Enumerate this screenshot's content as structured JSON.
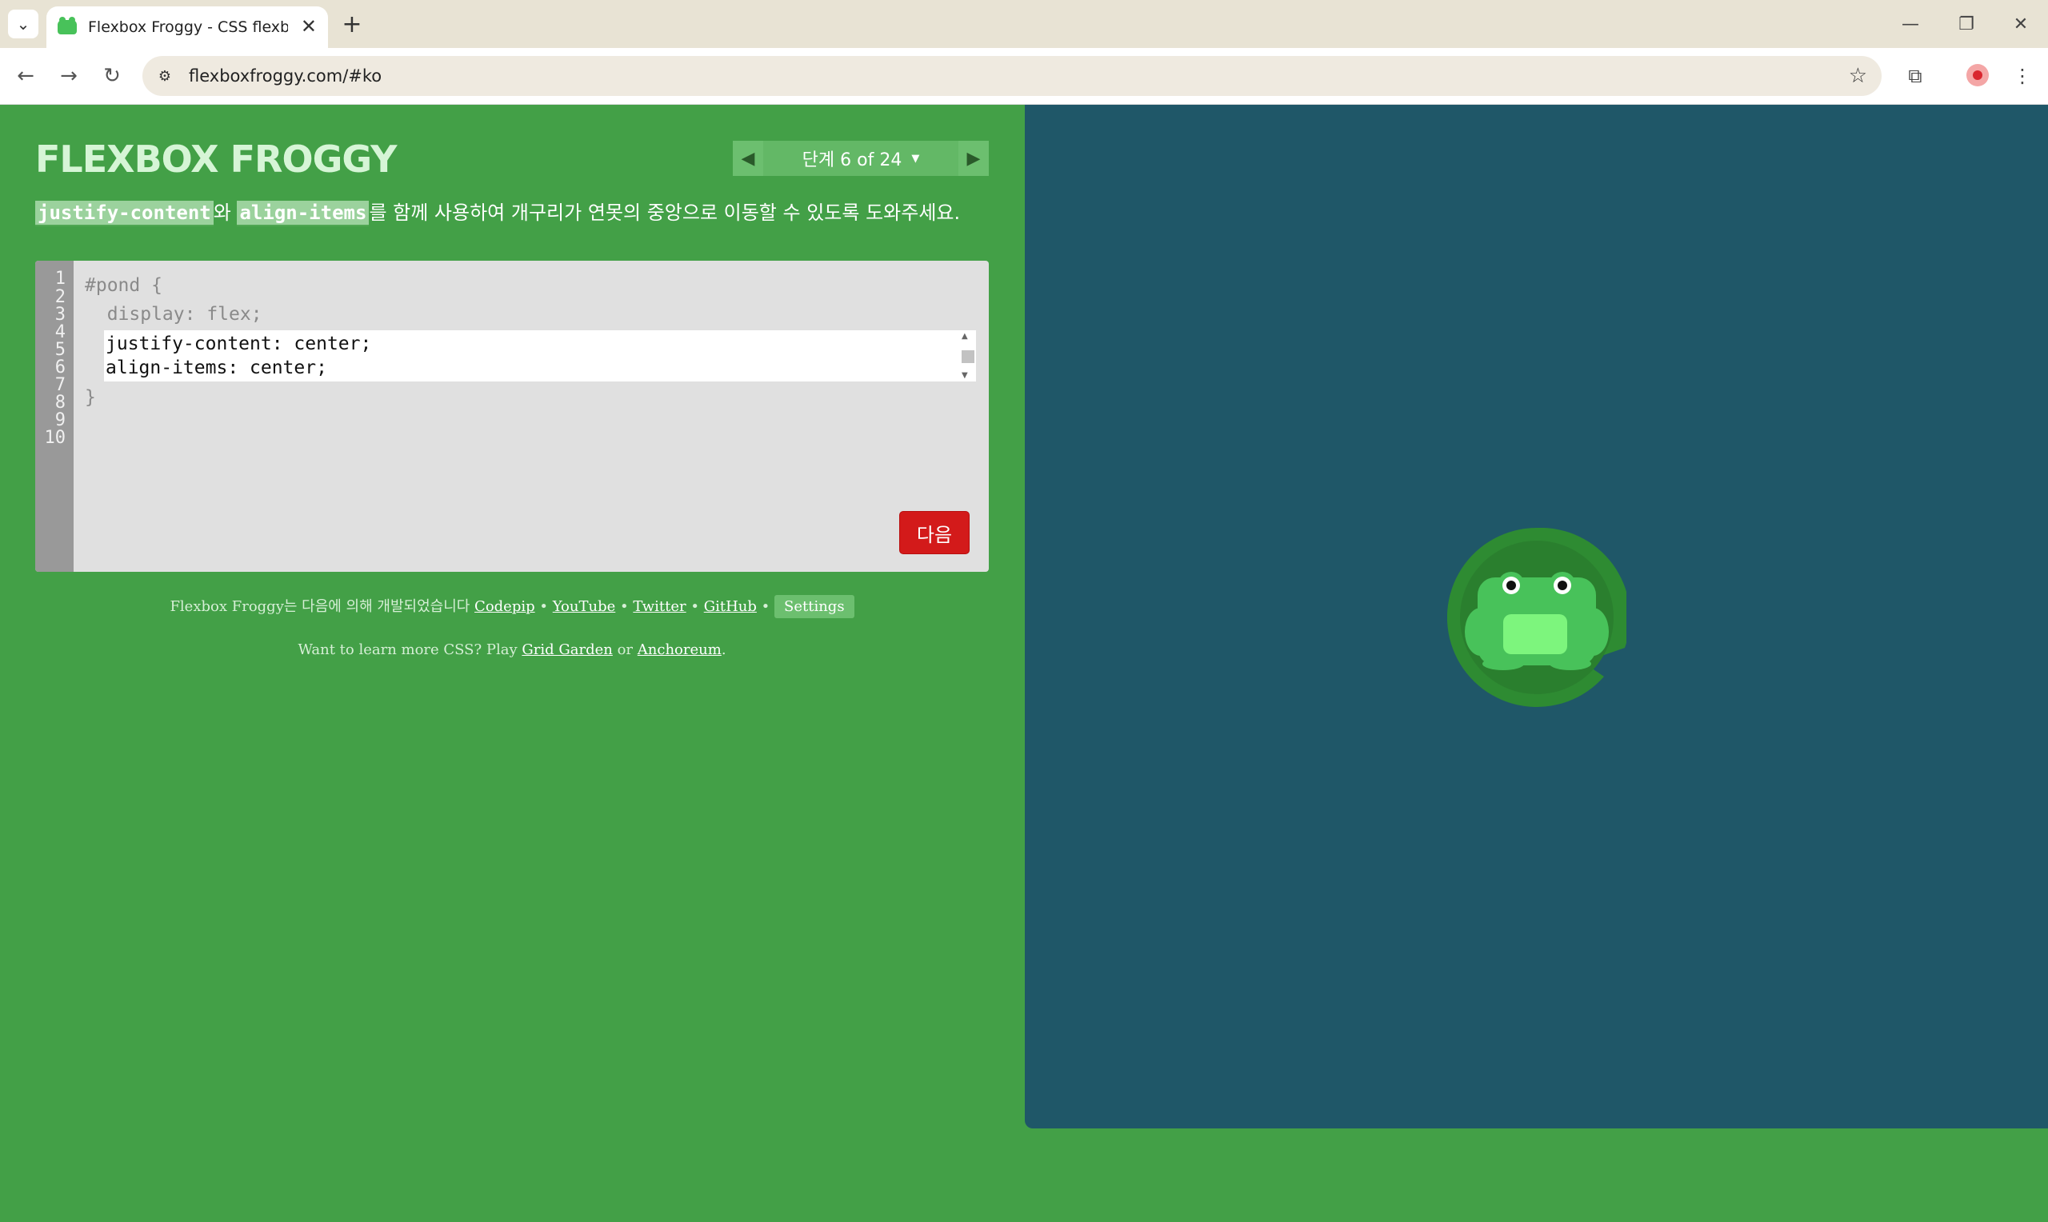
{
  "browser": {
    "tab_title": "Flexbox Froggy - CSS flexbox",
    "url": "flexboxfroggy.com/#ko",
    "icons": {
      "tab_search": "chevron-down-icon",
      "close": "close-icon",
      "new_tab": "plus-icon",
      "back": "back-arrow-icon",
      "forward": "forward-arrow-icon",
      "reload": "reload-icon",
      "site_info": "tune-icon",
      "bookmark": "star-icon",
      "extensions": "puzzle-icon",
      "menu": "kebab-menu-icon"
    }
  },
  "game": {
    "logo": "FLEXBOX FROGGY",
    "level": {
      "label": "단계 6 of 24"
    },
    "instructions": {
      "keyword1": "justify-content",
      "connector": "와",
      "keyword2": "align-items",
      "rest": "를 함께 사용하여 개구리가 연못의 중앙으로 이동할 수 있도록 도와주세요."
    },
    "editor": {
      "line_numbers": [
        "1",
        "2",
        "3",
        "4",
        "5",
        "6",
        "7",
        "8",
        "9",
        "10"
      ],
      "line1": "#pond {",
      "line2": "  display: flex;",
      "input_line1": "justify-content: center;",
      "input_line2": "align-items: center;",
      "line5": "}",
      "next_label": "다음"
    },
    "credits": {
      "prefix": "Flexbox Froggy는 다음에 의해 개발되었습니다",
      "codepip": "Codepip",
      "youtube": "YouTube",
      "twitter": "Twitter",
      "github": "GitHub",
      "settings": "Settings",
      "sep": "•"
    },
    "more": {
      "prefix": "Want to learn more CSS? Play",
      "grid_garden": "Grid Garden",
      "or": "or",
      "anchoreum": "Anchoreum",
      "suffix": "."
    }
  },
  "colors": {
    "page_green": "#43a047",
    "pond_blue": "#1f5768",
    "lilypad": "#2e8b32",
    "frog": "#48c25a",
    "next_red": "#d31a1a"
  }
}
